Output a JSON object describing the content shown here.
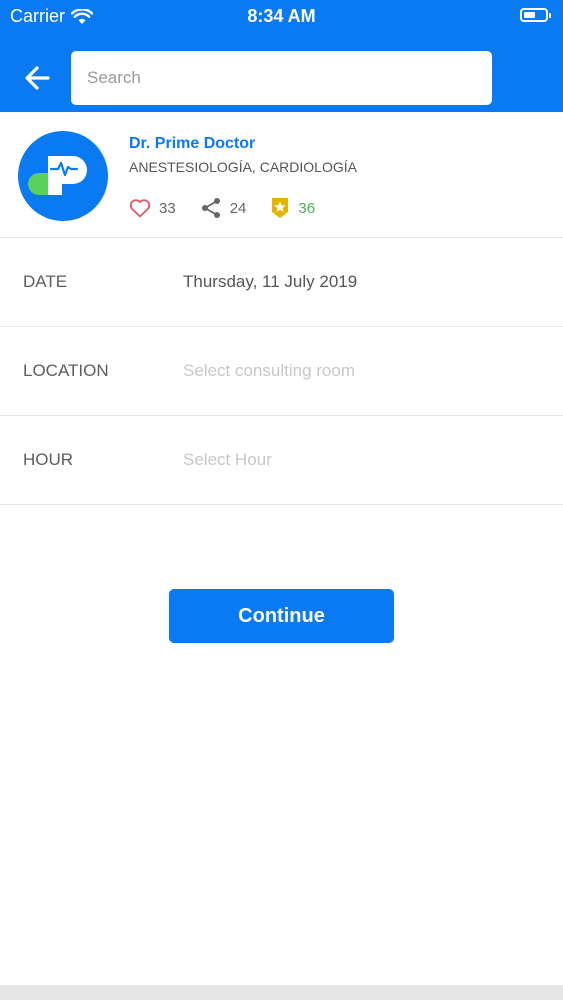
{
  "status_bar": {
    "carrier": "Carrier",
    "time": "8:34 AM",
    "battery_level": 0.55
  },
  "header": {
    "search_placeholder": "Search",
    "background_color": "#0a7af3"
  },
  "doctor": {
    "name": "Dr. Prime Doctor",
    "specialties": "ANESTESIOLOGÍA, CARDIOLOGÍA",
    "stats": {
      "likes": "33",
      "shares": "24",
      "rating": "36"
    }
  },
  "form": {
    "date_label": "DATE",
    "date_value": "Thursday, 11 July 2019",
    "location_label": "LOCATION",
    "location_placeholder": "Select consulting room",
    "hour_label": "HOUR",
    "hour_placeholder": "Select Hour"
  },
  "actions": {
    "continue_label": "Continue"
  },
  "icons": {
    "back": "arrow-left-icon",
    "wifi": "wifi-icon",
    "battery": "battery-icon",
    "like": "heart-icon",
    "share": "share-icon",
    "rating": "badge-star-icon"
  },
  "colors": {
    "accent": "#0a7af3",
    "heart": "#e05563",
    "badge": "#e6b400",
    "rating_text": "#4caf50"
  }
}
